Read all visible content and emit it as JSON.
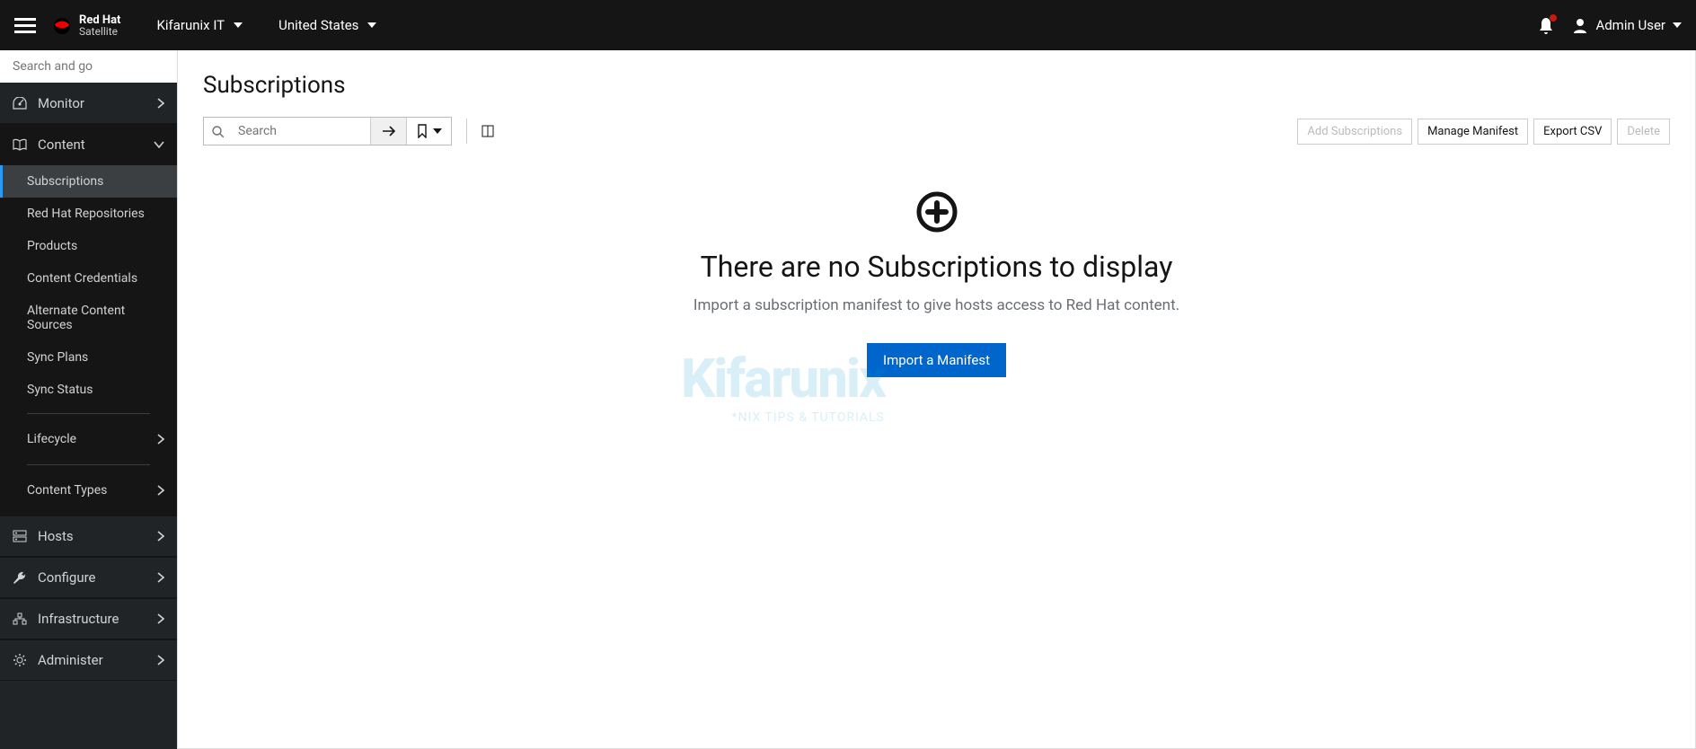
{
  "header": {
    "brand_top": "Red Hat",
    "brand_bottom": "Satellite",
    "org_name": "Kifarunix IT",
    "location": "United States",
    "user_name": "Admin User"
  },
  "sidebar": {
    "search_placeholder": "Search and go",
    "items": [
      {
        "label": "Monitor",
        "icon": "dashboard"
      },
      {
        "label": "Content",
        "icon": "book",
        "expanded": true
      },
      {
        "label": "Hosts",
        "icon": "server"
      },
      {
        "label": "Configure",
        "icon": "wrench"
      },
      {
        "label": "Infrastructure",
        "icon": "structure"
      },
      {
        "label": "Administer",
        "icon": "gear"
      }
    ],
    "content_sub": [
      {
        "label": "Subscriptions",
        "active": true
      },
      {
        "label": "Red Hat Repositories"
      },
      {
        "label": "Products"
      },
      {
        "label": "Content Credentials"
      },
      {
        "label": "Alternate Content Sources"
      },
      {
        "label": "Sync Plans"
      },
      {
        "label": "Sync Status"
      }
    ],
    "content_groups": [
      {
        "label": "Lifecycle"
      },
      {
        "label": "Content Types"
      }
    ]
  },
  "main": {
    "title": "Subscriptions",
    "search_placeholder": "Search",
    "buttons": {
      "add": "Add Subscriptions",
      "manage": "Manage Manifest",
      "export": "Export CSV",
      "delete": "Delete"
    },
    "empty": {
      "title": "There are no Subscriptions to display",
      "desc": "Import a subscription manifest to give hosts access to Red Hat content.",
      "button": "Import a Manifest"
    }
  },
  "watermark": {
    "text": "Kifarunix",
    "sub": "*NIX TIPS & TUTORIALS"
  }
}
